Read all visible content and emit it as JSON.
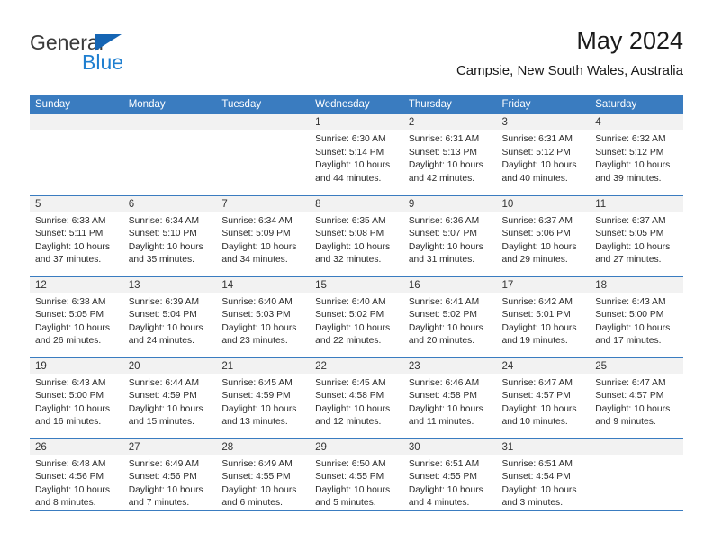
{
  "logo": {
    "word1": "General",
    "word2": "Blue",
    "triangle_color": "#1565b4",
    "word2_color": "#1f7fd0"
  },
  "header": {
    "title": "May 2024",
    "subtitle": "Campsie, New South Wales, Australia"
  },
  "theme": {
    "header_bg": "#3a7cc0",
    "band_bg": "#f2f2f2",
    "rule_color": "#3a7cc0"
  },
  "weekday_headers": [
    "Sunday",
    "Monday",
    "Tuesday",
    "Wednesday",
    "Thursday",
    "Friday",
    "Saturday"
  ],
  "weeks": [
    [
      {
        "day": "",
        "empty": true,
        "sunrise": "",
        "sunset": "",
        "daylight1": "",
        "daylight2": ""
      },
      {
        "day": "",
        "empty": true,
        "sunrise": "",
        "sunset": "",
        "daylight1": "",
        "daylight2": ""
      },
      {
        "day": "",
        "empty": true,
        "sunrise": "",
        "sunset": "",
        "daylight1": "",
        "daylight2": ""
      },
      {
        "day": "1",
        "empty": false,
        "sunrise": "Sunrise: 6:30 AM",
        "sunset": "Sunset: 5:14 PM",
        "daylight1": "Daylight: 10 hours",
        "daylight2": "and 44 minutes."
      },
      {
        "day": "2",
        "empty": false,
        "sunrise": "Sunrise: 6:31 AM",
        "sunset": "Sunset: 5:13 PM",
        "daylight1": "Daylight: 10 hours",
        "daylight2": "and 42 minutes."
      },
      {
        "day": "3",
        "empty": false,
        "sunrise": "Sunrise: 6:31 AM",
        "sunset": "Sunset: 5:12 PM",
        "daylight1": "Daylight: 10 hours",
        "daylight2": "and 40 minutes."
      },
      {
        "day": "4",
        "empty": false,
        "sunrise": "Sunrise: 6:32 AM",
        "sunset": "Sunset: 5:12 PM",
        "daylight1": "Daylight: 10 hours",
        "daylight2": "and 39 minutes."
      }
    ],
    [
      {
        "day": "5",
        "empty": false,
        "sunrise": "Sunrise: 6:33 AM",
        "sunset": "Sunset: 5:11 PM",
        "daylight1": "Daylight: 10 hours",
        "daylight2": "and 37 minutes."
      },
      {
        "day": "6",
        "empty": false,
        "sunrise": "Sunrise: 6:34 AM",
        "sunset": "Sunset: 5:10 PM",
        "daylight1": "Daylight: 10 hours",
        "daylight2": "and 35 minutes."
      },
      {
        "day": "7",
        "empty": false,
        "sunrise": "Sunrise: 6:34 AM",
        "sunset": "Sunset: 5:09 PM",
        "daylight1": "Daylight: 10 hours",
        "daylight2": "and 34 minutes."
      },
      {
        "day": "8",
        "empty": false,
        "sunrise": "Sunrise: 6:35 AM",
        "sunset": "Sunset: 5:08 PM",
        "daylight1": "Daylight: 10 hours",
        "daylight2": "and 32 minutes."
      },
      {
        "day": "9",
        "empty": false,
        "sunrise": "Sunrise: 6:36 AM",
        "sunset": "Sunset: 5:07 PM",
        "daylight1": "Daylight: 10 hours",
        "daylight2": "and 31 minutes."
      },
      {
        "day": "10",
        "empty": false,
        "sunrise": "Sunrise: 6:37 AM",
        "sunset": "Sunset: 5:06 PM",
        "daylight1": "Daylight: 10 hours",
        "daylight2": "and 29 minutes."
      },
      {
        "day": "11",
        "empty": false,
        "sunrise": "Sunrise: 6:37 AM",
        "sunset": "Sunset: 5:05 PM",
        "daylight1": "Daylight: 10 hours",
        "daylight2": "and 27 minutes."
      }
    ],
    [
      {
        "day": "12",
        "empty": false,
        "sunrise": "Sunrise: 6:38 AM",
        "sunset": "Sunset: 5:05 PM",
        "daylight1": "Daylight: 10 hours",
        "daylight2": "and 26 minutes."
      },
      {
        "day": "13",
        "empty": false,
        "sunrise": "Sunrise: 6:39 AM",
        "sunset": "Sunset: 5:04 PM",
        "daylight1": "Daylight: 10 hours",
        "daylight2": "and 24 minutes."
      },
      {
        "day": "14",
        "empty": false,
        "sunrise": "Sunrise: 6:40 AM",
        "sunset": "Sunset: 5:03 PM",
        "daylight1": "Daylight: 10 hours",
        "daylight2": "and 23 minutes."
      },
      {
        "day": "15",
        "empty": false,
        "sunrise": "Sunrise: 6:40 AM",
        "sunset": "Sunset: 5:02 PM",
        "daylight1": "Daylight: 10 hours",
        "daylight2": "and 22 minutes."
      },
      {
        "day": "16",
        "empty": false,
        "sunrise": "Sunrise: 6:41 AM",
        "sunset": "Sunset: 5:02 PM",
        "daylight1": "Daylight: 10 hours",
        "daylight2": "and 20 minutes."
      },
      {
        "day": "17",
        "empty": false,
        "sunrise": "Sunrise: 6:42 AM",
        "sunset": "Sunset: 5:01 PM",
        "daylight1": "Daylight: 10 hours",
        "daylight2": "and 19 minutes."
      },
      {
        "day": "18",
        "empty": false,
        "sunrise": "Sunrise: 6:43 AM",
        "sunset": "Sunset: 5:00 PM",
        "daylight1": "Daylight: 10 hours",
        "daylight2": "and 17 minutes."
      }
    ],
    [
      {
        "day": "19",
        "empty": false,
        "sunrise": "Sunrise: 6:43 AM",
        "sunset": "Sunset: 5:00 PM",
        "daylight1": "Daylight: 10 hours",
        "daylight2": "and 16 minutes."
      },
      {
        "day": "20",
        "empty": false,
        "sunrise": "Sunrise: 6:44 AM",
        "sunset": "Sunset: 4:59 PM",
        "daylight1": "Daylight: 10 hours",
        "daylight2": "and 15 minutes."
      },
      {
        "day": "21",
        "empty": false,
        "sunrise": "Sunrise: 6:45 AM",
        "sunset": "Sunset: 4:59 PM",
        "daylight1": "Daylight: 10 hours",
        "daylight2": "and 13 minutes."
      },
      {
        "day": "22",
        "empty": false,
        "sunrise": "Sunrise: 6:45 AM",
        "sunset": "Sunset: 4:58 PM",
        "daylight1": "Daylight: 10 hours",
        "daylight2": "and 12 minutes."
      },
      {
        "day": "23",
        "empty": false,
        "sunrise": "Sunrise: 6:46 AM",
        "sunset": "Sunset: 4:58 PM",
        "daylight1": "Daylight: 10 hours",
        "daylight2": "and 11 minutes."
      },
      {
        "day": "24",
        "empty": false,
        "sunrise": "Sunrise: 6:47 AM",
        "sunset": "Sunset: 4:57 PM",
        "daylight1": "Daylight: 10 hours",
        "daylight2": "and 10 minutes."
      },
      {
        "day": "25",
        "empty": false,
        "sunrise": "Sunrise: 6:47 AM",
        "sunset": "Sunset: 4:57 PM",
        "daylight1": "Daylight: 10 hours",
        "daylight2": "and 9 minutes."
      }
    ],
    [
      {
        "day": "26",
        "empty": false,
        "sunrise": "Sunrise: 6:48 AM",
        "sunset": "Sunset: 4:56 PM",
        "daylight1": "Daylight: 10 hours",
        "daylight2": "and 8 minutes."
      },
      {
        "day": "27",
        "empty": false,
        "sunrise": "Sunrise: 6:49 AM",
        "sunset": "Sunset: 4:56 PM",
        "daylight1": "Daylight: 10 hours",
        "daylight2": "and 7 minutes."
      },
      {
        "day": "28",
        "empty": false,
        "sunrise": "Sunrise: 6:49 AM",
        "sunset": "Sunset: 4:55 PM",
        "daylight1": "Daylight: 10 hours",
        "daylight2": "and 6 minutes."
      },
      {
        "day": "29",
        "empty": false,
        "sunrise": "Sunrise: 6:50 AM",
        "sunset": "Sunset: 4:55 PM",
        "daylight1": "Daylight: 10 hours",
        "daylight2": "and 5 minutes."
      },
      {
        "day": "30",
        "empty": false,
        "sunrise": "Sunrise: 6:51 AM",
        "sunset": "Sunset: 4:55 PM",
        "daylight1": "Daylight: 10 hours",
        "daylight2": "and 4 minutes."
      },
      {
        "day": "31",
        "empty": false,
        "sunrise": "Sunrise: 6:51 AM",
        "sunset": "Sunset: 4:54 PM",
        "daylight1": "Daylight: 10 hours",
        "daylight2": "and 3 minutes."
      },
      {
        "day": "",
        "empty": true,
        "sunrise": "",
        "sunset": "",
        "daylight1": "",
        "daylight2": ""
      }
    ]
  ]
}
